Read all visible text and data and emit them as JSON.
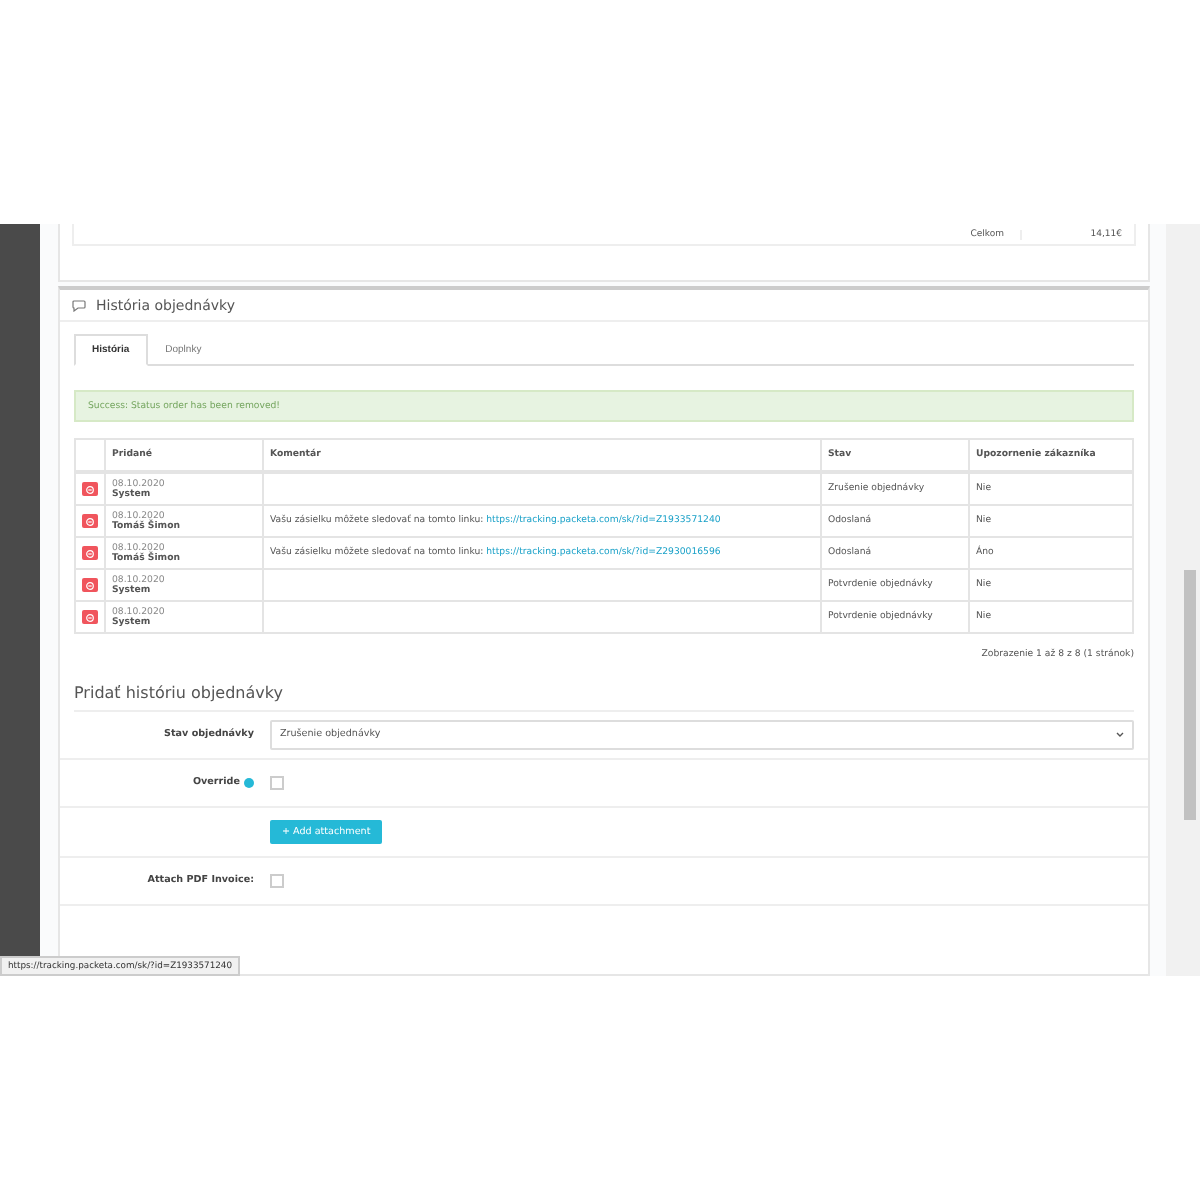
{
  "order_total": {
    "label": "Celkom",
    "value": "14,11€"
  },
  "history_panel": {
    "title": "História objednávky",
    "tabs": [
      {
        "label": "História",
        "selected": true
      },
      {
        "label": "Doplnky",
        "selected": false
      }
    ],
    "alert": "Success: Status order has been removed!",
    "table": {
      "columns": [
        "Pridané",
        "Komentár",
        "Stav",
        "Upozornenie zákazníka"
      ],
      "rows": [
        {
          "date": "08.10.2020",
          "author": "System",
          "comment": "",
          "link": "",
          "status": "Zrušenie objednávky",
          "notify": "Nie"
        },
        {
          "date": "08.10.2020",
          "author": "Tomáš Šimon",
          "comment": "Vašu zásielku môžete sledovať na tomto linku:",
          "link": "https://tracking.packeta.com/sk/?id=Z1933571240",
          "status": "Odoslaná",
          "notify": "Nie"
        },
        {
          "date": "08.10.2020",
          "author": "Tomáš Šimon",
          "comment": "Vašu zásielku môžete sledovať na tomto linku:",
          "link": "https://tracking.packeta.com/sk/?id=Z2930016596",
          "status": "Odoslaná",
          "notify": "Áno"
        },
        {
          "date": "08.10.2020",
          "author": "System",
          "comment": "",
          "link": "",
          "status": "Potvrdenie objednávky",
          "notify": "Nie"
        },
        {
          "date": "08.10.2020",
          "author": "System",
          "comment": "",
          "link": "",
          "status": "Potvrdenie objednávky",
          "notify": "Nie"
        }
      ]
    },
    "pagination": "Zobrazenie 1 až 8 z 8 (1 stránok)"
  },
  "add_history": {
    "title": "Pridať históriu objednávky",
    "status_select": {
      "label": "Stav objednávky",
      "value": "Zrušenie objednávky"
    },
    "override": {
      "label": "Override",
      "checked": false
    },
    "add_attachment_button": "+ Add attachment",
    "attach_pdf": {
      "label": "Attach PDF Invoice:",
      "checked": false
    }
  },
  "status_bar_url": "https://tracking.packeta.com/sk/?id=Z1933571240"
}
